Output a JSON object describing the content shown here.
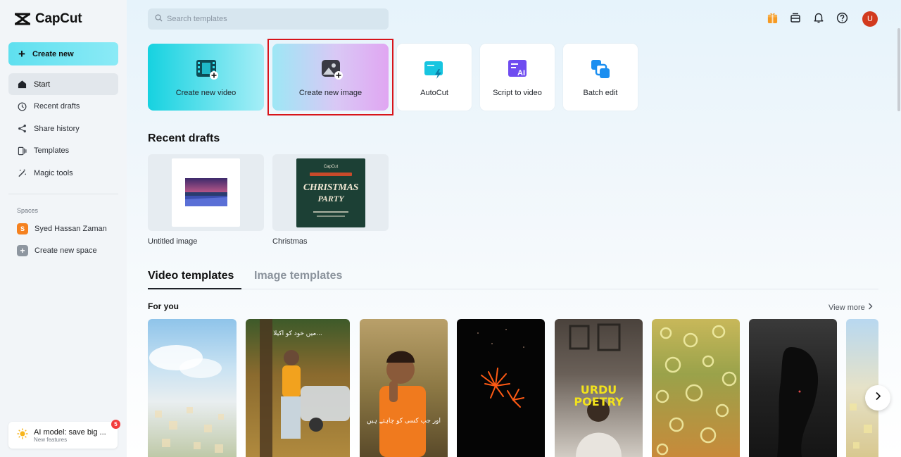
{
  "app": {
    "name": "CapCut"
  },
  "sidebar": {
    "create_new_label": "Create new",
    "items": [
      {
        "label": "Start",
        "icon": "home-icon",
        "active": true
      },
      {
        "label": "Recent drafts",
        "icon": "clock-icon"
      },
      {
        "label": "Share history",
        "icon": "share-icon"
      },
      {
        "label": "Templates",
        "icon": "templates-icon"
      },
      {
        "label": "Magic tools",
        "icon": "magic-wand-icon"
      }
    ],
    "spaces_label": "Spaces",
    "spaces": [
      {
        "label": "Syed Hassan Zaman",
        "badge": "S",
        "color": "#f5811f"
      },
      {
        "label": "Create new space",
        "badge": "+",
        "color": "#8e96a0"
      }
    ],
    "promo": {
      "title": "AI model: save big ...",
      "subtitle": "New features",
      "count": "5"
    }
  },
  "header": {
    "search_placeholder": "Search templates",
    "avatar_letter": "U",
    "icons": [
      "gift-icon",
      "subscription-icon",
      "bell-icon",
      "help-icon"
    ]
  },
  "quick_actions": [
    {
      "label": "Create new video",
      "icon": "video-film-icon"
    },
    {
      "label": "Create new image",
      "icon": "image-add-icon"
    },
    {
      "label": "AutoCut",
      "icon": "autocut-icon"
    },
    {
      "label": "Script to video",
      "icon": "script-ai-icon"
    },
    {
      "label": "Batch edit",
      "icon": "batch-edit-icon"
    }
  ],
  "recent_drafts": {
    "title": "Recent drafts",
    "items": [
      {
        "label": "Untitled image"
      },
      {
        "label": "Christmas",
        "thumb_title": "CHRISTMAS",
        "thumb_sub": "PARTY",
        "thumb_brand": "CapCut"
      }
    ]
  },
  "templates": {
    "tabs": [
      {
        "label": "Video templates",
        "active": true
      },
      {
        "label": "Image templates",
        "active": false
      }
    ],
    "section_label": "For you",
    "view_more": "View more",
    "cards": [
      {
        "theme": "sky-bokeh"
      },
      {
        "theme": "man-car-autumn",
        "text": "میں خود کو اکیلا..."
      },
      {
        "theme": "man-orange-shirt",
        "text": "اور جب کسی کو چاہتے ہیں"
      },
      {
        "theme": "fireworks-night"
      },
      {
        "theme": "urdu-poetry",
        "text": "URDU POETRY"
      },
      {
        "theme": "bokeh-rings"
      },
      {
        "theme": "dark-portrait"
      },
      {
        "theme": "partial-blue"
      }
    ]
  },
  "colors": {
    "accent_cyan": "#16d2e0",
    "highlight_red": "#d8141a",
    "avatar": "#d23a1e"
  }
}
